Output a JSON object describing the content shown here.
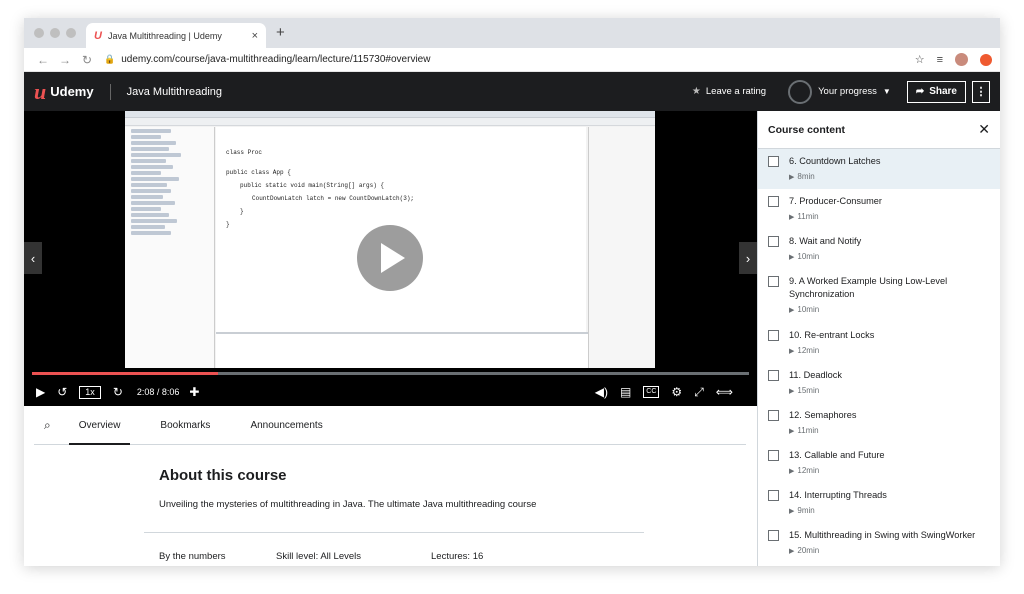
{
  "browser": {
    "tab_title": "Java Multithreading | Udemy",
    "tab_favicon": "U",
    "url": "udemy.com/course/java-multithreading/learn/lecture/115730#overview",
    "new_tab": "+",
    "close_tab": "×"
  },
  "header": {
    "logo_mark": "u",
    "logo_text": "Udemy",
    "course_title": "Java Multithreading",
    "rating_label": "Leave a rating",
    "progress_label": "Your progress",
    "share_label": "Share",
    "more_label": "⋮"
  },
  "video": {
    "speed": "1x",
    "time": "2:08 / 8:06",
    "progress_fraction": 0.26,
    "code_lines": [
      "class Proc",
      "public class App {",
      "public static void main(String[] args) {",
      "CountDownLatch latch = new CountDownLatch(3);",
      "}",
      "}"
    ]
  },
  "tabs": {
    "items": [
      "Overview",
      "Bookmarks",
      "Announcements"
    ],
    "active": "Overview"
  },
  "about": {
    "title": "About this course",
    "description": "Unveiling the mysteries of multithreading in Java. The ultimate Java multithreading course",
    "by_numbers": "By the numbers",
    "skill_level": "Skill level: All Levels",
    "lectures": "Lectures: 16"
  },
  "sidebar": {
    "title": "Course content",
    "items": [
      {
        "label": "6. Countdown Latches",
        "duration": "8min"
      },
      {
        "label": "7. Producer-Consumer",
        "duration": "11min"
      },
      {
        "label": "8. Wait and Notify",
        "duration": "10min"
      },
      {
        "label": "9. A Worked Example Using Low-Level Synchronization",
        "duration": "10min"
      },
      {
        "label": "10. Re-entrant Locks",
        "duration": "12min"
      },
      {
        "label": "11. Deadlock",
        "duration": "15min"
      },
      {
        "label": "12. Semaphores",
        "duration": "11min"
      },
      {
        "label": "13. Callable and Future",
        "duration": "12min"
      },
      {
        "label": "14. Interrupting Threads",
        "duration": "9min"
      },
      {
        "label": "15. Multithreading in Swing with SwingWorker",
        "duration": "20min"
      }
    ]
  },
  "colors": {
    "brand": "#ec5252",
    "header_bg": "#1c1d1f",
    "active_item_bg": "#e8f0f5"
  }
}
